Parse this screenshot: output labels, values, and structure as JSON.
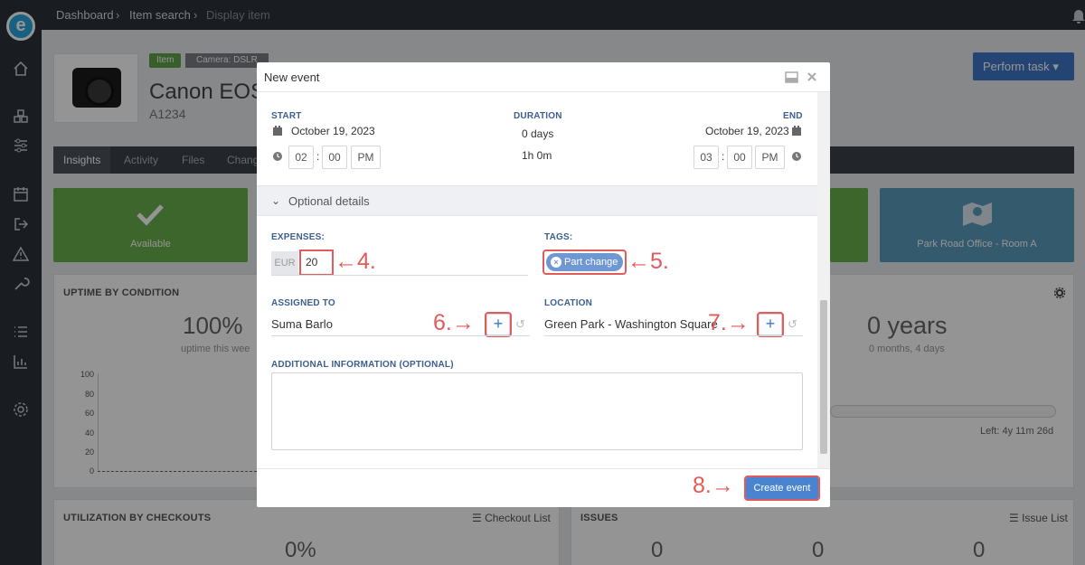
{
  "app": {
    "logo_letter": "e"
  },
  "breadcrumb": {
    "items": [
      "Dashboard",
      "Item search",
      "Display item"
    ]
  },
  "item": {
    "tag_item": "Item",
    "tag_category": "Camera: DSLR",
    "title": "Canon EOS",
    "code": "A1234",
    "perform_task_label": "Perform task"
  },
  "tabs": [
    "Insights",
    "Activity",
    "Files",
    "Chang"
  ],
  "tiles": {
    "available_label": "Available",
    "location_label": "Park Road Office - Room A"
  },
  "uptime": {
    "title": "UPTIME BY CONDITION",
    "percent": "100%",
    "subtitle": "uptime this wee",
    "y_ticks": [
      "100",
      "80",
      "60",
      "40",
      "20",
      "0"
    ]
  },
  "age": {
    "value": "0 years",
    "detail": "0 months, 4 days",
    "left_text": "Left: 4y 11m 26d"
  },
  "utilization": {
    "title": "UTILIZATION BY CHECKOUTS",
    "link": "Checkout List",
    "value": "0%"
  },
  "issues": {
    "title": "ISSUES",
    "link": "Issue List",
    "values": [
      "0",
      "0",
      "0"
    ]
  },
  "modal": {
    "title": "New event",
    "start_label": "START",
    "start_date": "October 19, 2023",
    "start_hour": "02",
    "start_minute": "00",
    "start_ampm": "PM",
    "duration_label": "DURATION",
    "duration_days": "0 days",
    "duration_time": "1h 0m",
    "end_label": "END",
    "end_date": "October 19, 2023",
    "end_hour": "03",
    "end_minute": "00",
    "end_ampm": "PM",
    "optional_label": "Optional details",
    "expenses_label": "EXPENSES:",
    "currency": "EUR",
    "expenses_value": "20",
    "tags_label": "TAGS:",
    "tag_value": "Part change",
    "assigned_label": "ASSIGNED TO",
    "assigned_value": "Suma Barlo",
    "location_label": "LOCATION",
    "location_value": "Green Park - Washington Square",
    "additional_label": "ADDITIONAL INFORMATION (OPTIONAL)",
    "additional_value": "",
    "create_label": "Create event"
  },
  "annotations": [
    "4.",
    "5.",
    "6.",
    "7.",
    "8."
  ],
  "colors": {
    "sidebar": "#2c3138",
    "accent": "#3f78c6",
    "available_tile": "#6ab04c",
    "location_tile": "#5b9bbe",
    "highlight": "#e35a5a"
  }
}
